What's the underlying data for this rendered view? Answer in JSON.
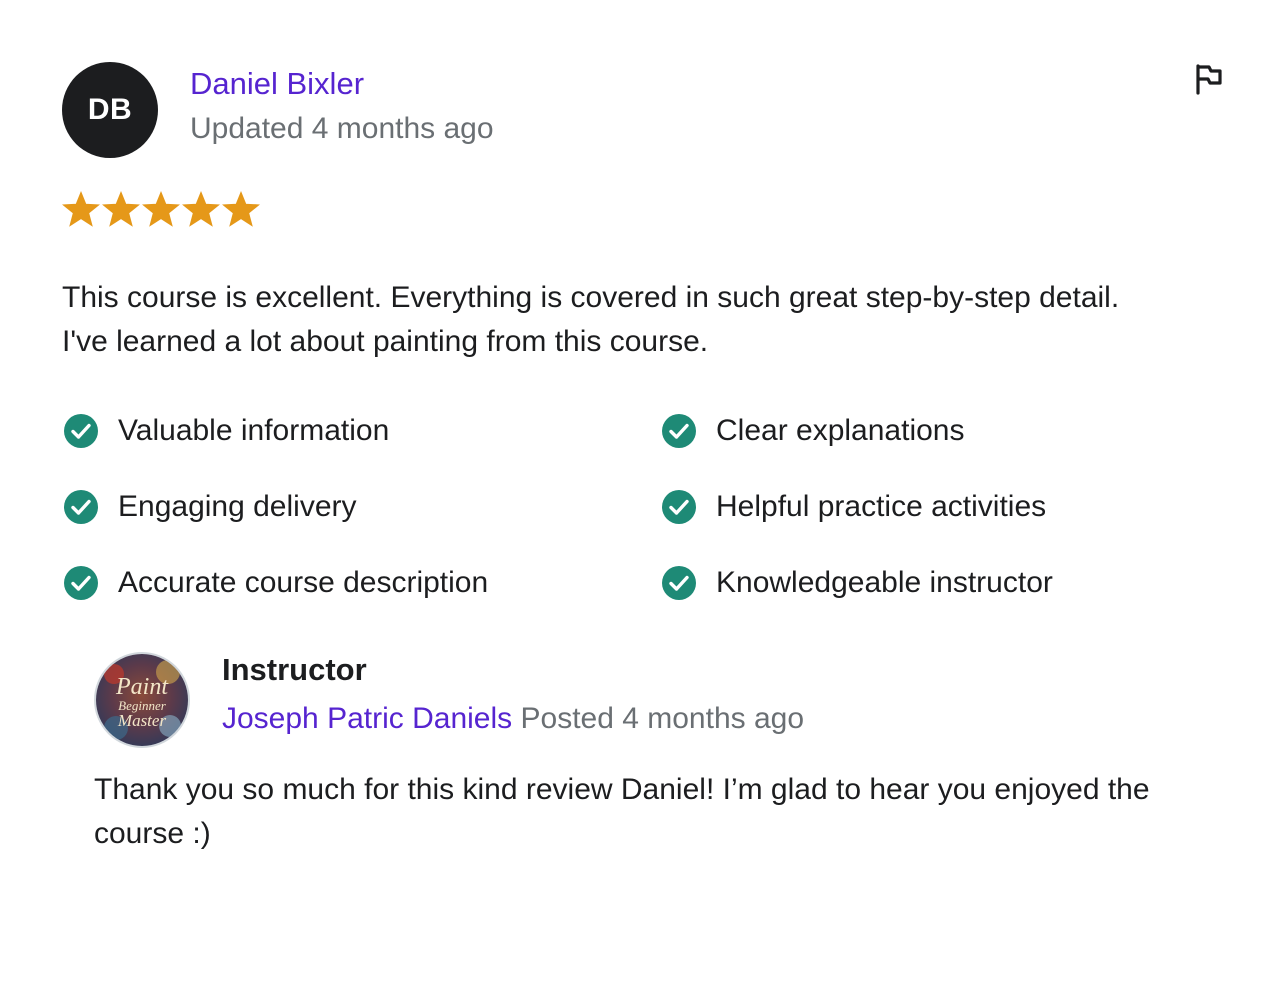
{
  "review": {
    "avatar_initials": "DB",
    "reviewer_name": "Daniel Bixler",
    "date": "Updated 4 months ago",
    "rating": 5,
    "rating_max": 5,
    "star_color": "#e59819",
    "text_lines": [
      "This course is excellent. Everything is covered in such great step-by-step detail.",
      "I've learned a lot about painting from this course."
    ],
    "features": [
      {
        "label": "Valuable information",
        "icon": "check-circle-icon"
      },
      {
        "label": "Clear explanations",
        "icon": "check-circle-icon"
      },
      {
        "label": "Engaging delivery",
        "icon": "check-circle-icon"
      },
      {
        "label": "Helpful practice activities",
        "icon": "check-circle-icon"
      },
      {
        "label": "Accurate course description",
        "icon": "check-circle-icon"
      },
      {
        "label": "Knowledgeable instructor",
        "icon": "check-circle-icon"
      }
    ],
    "flag_icon": "flag-icon"
  },
  "reply": {
    "role": "Instructor",
    "name": "Joseph Patric Daniels",
    "posted": "Posted 4 months ago",
    "avatar_logo_lines": [
      "Paint",
      "Beginner",
      "Master"
    ],
    "text": "Thank you so much for this kind review Daniel! I’m glad to hear you enjoyed the course :)"
  },
  "colors": {
    "link": "#5624d0",
    "muted": "#6a6f73",
    "check": "#1e8a76",
    "avatar_bg": "#1c1d1f"
  }
}
